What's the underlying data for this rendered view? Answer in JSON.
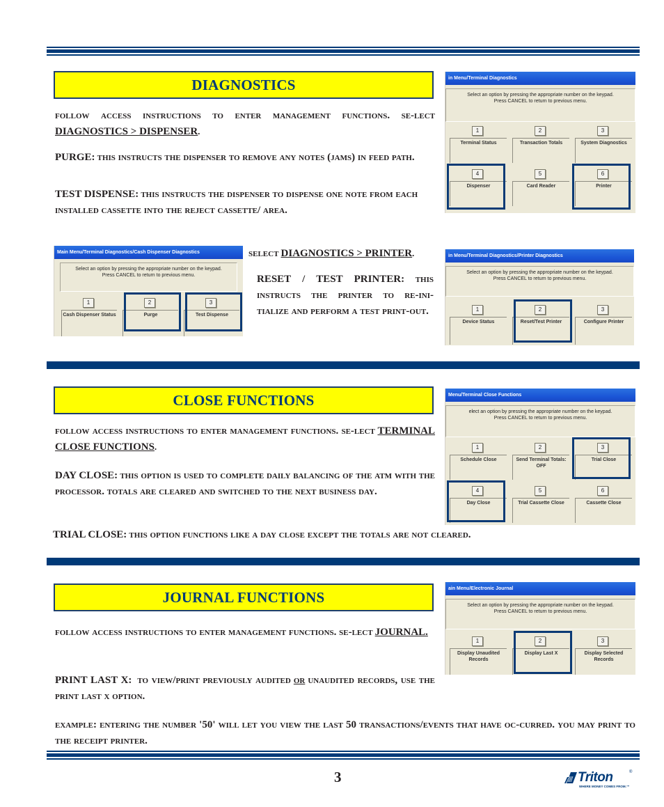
{
  "page": {
    "number": "3"
  },
  "brand": {
    "name": "Triton",
    "trademark": "®",
    "tagline": "WHERE MONEY COMES FROM.™",
    "color": "#003a78"
  },
  "colors": {
    "header_blue": "#003a78",
    "title_fill": "#ffff00",
    "highlight_border": "#0b3a75"
  },
  "diagnostics": {
    "title": "DIAGNOSTICS",
    "intro": {
      "text": "Follow Access instructions to enter Management Functions.  Se-lect",
      "link": "DIAGNOSTICS > DISPENSER",
      "end": "."
    },
    "purge": {
      "label": "PURGE:",
      "text": "This instructs the dispenser to remove any notes (jams) in feed path."
    },
    "test_dispense": {
      "label": "TEST DISPENSE:",
      "text": "This instructs the dispenser to dispense one note from each installed cassette into the reject cassette/ area."
    },
    "printer_select": {
      "prefix": "Select",
      "link": "DIAGNOSTICS > PRINTER",
      "end": "."
    },
    "reset_test": {
      "label": "RESET / TEST PRINTER:",
      "text": "This instructs the printer to re-ini-tialize and perform a test print-out."
    },
    "screen_main": {
      "title": "in Menu/Terminal Diagnostics",
      "message": [
        "Select an option by pressing the appropriate number on the keypad.",
        "Press CANCEL to return to previous menu."
      ],
      "options": [
        {
          "num": "1",
          "label": "Terminal Status",
          "highlighted": false
        },
        {
          "num": "2",
          "label": "Transaction Totals",
          "highlighted": false
        },
        {
          "num": "3",
          "label": "System Diagnostics",
          "highlighted": false
        },
        {
          "num": "4",
          "label": "Dispenser",
          "highlighted": true
        },
        {
          "num": "5",
          "label": "Card Reader",
          "highlighted": false
        },
        {
          "num": "6",
          "label": "Printer",
          "highlighted": true
        }
      ]
    },
    "screen_dispenser": {
      "title": "Main Menu/Terminal Diagnostics/Cash Dispenser Diagnostics",
      "message": [
        "Select an option by pressing the appropriate number on the keypad.",
        "Press CANCEL to return to previous menu."
      ],
      "options": [
        {
          "num": "1",
          "label": "Cash Dispenser Status",
          "highlighted": false
        },
        {
          "num": "2",
          "label": "Purge",
          "highlighted": true
        },
        {
          "num": "3",
          "label": "Test Dispense",
          "highlighted": true
        }
      ]
    },
    "screen_printer": {
      "title": "in Menu/Terminal Diagnostics/Printer Diagnostics",
      "message": [
        "Select an option by pressing the appropriate number on the keypad.",
        "Press CANCEL to return to previous menu."
      ],
      "options": [
        {
          "num": "1",
          "label": "Device Status",
          "highlighted": false
        },
        {
          "num": "2",
          "label": "Reset/Test Printer",
          "highlighted": true
        },
        {
          "num": "3",
          "label": "Configure Printer",
          "highlighted": false
        }
      ]
    }
  },
  "close_functions": {
    "title": "CLOSE FUNCTIONS",
    "intro": {
      "text": "Follow Access instructions to enter Management Functions.  Se-lect",
      "link": "TERMINAL CLOSE FUNCTIONS",
      "end": "."
    },
    "day_close": {
      "label": "DAY CLOSE:",
      "text": "This option is used to complete daily balancing of the ATM with the processor. Totals are cleared and switched to the next business day."
    },
    "trial_close": {
      "label": "TRIAL CLOSE:",
      "text": "This option functions like a Day Close except the totals are not cleared."
    },
    "screen": {
      "title": "Menu/Terminal Close Functions",
      "message": [
        "elect an option by pressing the appropriate number on the keypad.",
        "Press CANCEL to return to previous menu."
      ],
      "options": [
        {
          "num": "1",
          "label": "Schedule Close",
          "highlighted": false
        },
        {
          "num": "2",
          "label": "Send Terminal Totals: OFF",
          "highlighted": false
        },
        {
          "num": "3",
          "label": "Trial Close",
          "highlighted": true
        },
        {
          "num": "4",
          "label": "Day Close",
          "highlighted": true
        },
        {
          "num": "5",
          "label": "Trial Cassette Close",
          "highlighted": false
        },
        {
          "num": "6",
          "label": "Cassette Close",
          "highlighted": false
        }
      ]
    }
  },
  "journal_functions": {
    "title": "JOURNAL FUNCTIONS",
    "intro": {
      "text": "Follow Access instructions to enter Management Functions.  Se-lect",
      "link": "JOURNAL.",
      "end": ""
    },
    "print_last_x": {
      "label": "PRINT LAST X:",
      "text_a": "To view/print previously audited",
      "or": "or",
      "text_b": "unaudited records, use the Print Last X option."
    },
    "example": {
      "text": "Example:  Entering the number '50' will let you view the last 50 transactions/events that have oc-curred. You may print to the receipt printer."
    },
    "screen": {
      "title": "ain Menu/Electronic Journal",
      "message": [
        "Select an option by pressing the appropriate number on the keypad.",
        "Press CANCEL to return to previous menu."
      ],
      "options": [
        {
          "num": "1",
          "label": "Display Unaudited Records",
          "highlighted": false
        },
        {
          "num": "2",
          "label": "Display Last X",
          "highlighted": true
        },
        {
          "num": "3",
          "label": "Display Selected Records",
          "highlighted": false
        }
      ]
    }
  }
}
